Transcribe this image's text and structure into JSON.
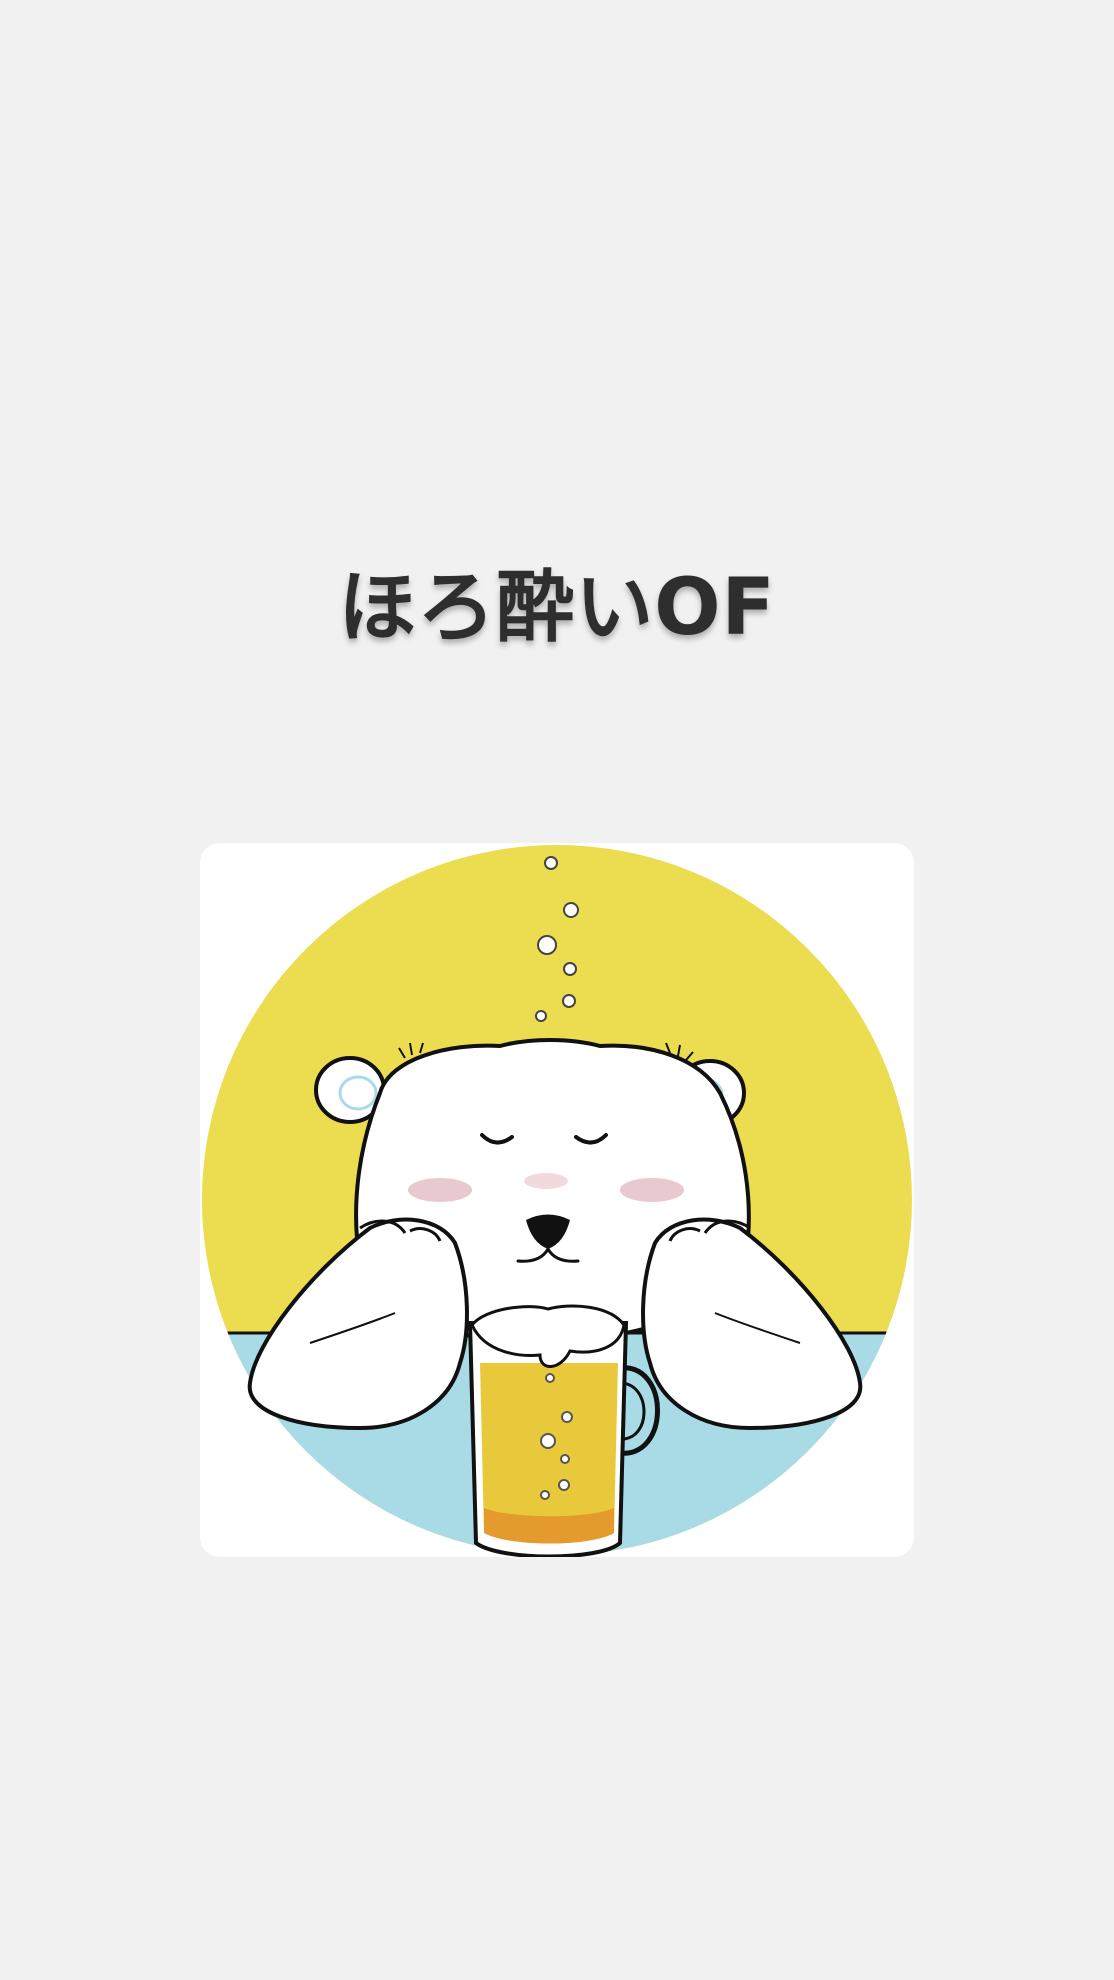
{
  "profile": {
    "name": "ほろ酔いOF"
  },
  "avatar": {
    "subject": "polar-bear-with-beer-icon",
    "colors": {
      "background_circle": "#ecdc4f",
      "table": "#a9dbe6",
      "card": "#ffffff",
      "beer": "#e9c93c",
      "outline": "#111111",
      "blush": "#e7c9cf"
    }
  }
}
